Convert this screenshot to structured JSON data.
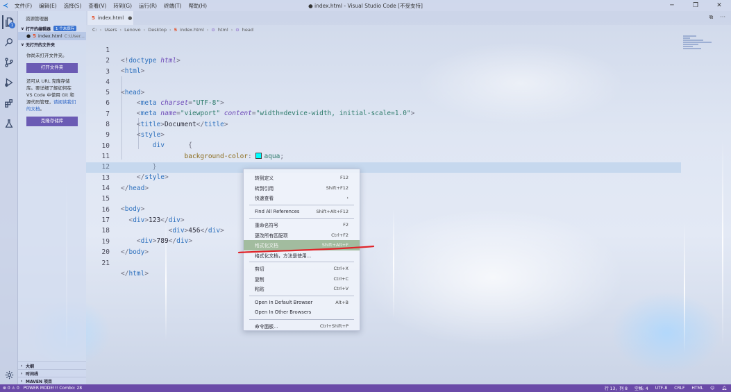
{
  "window": {
    "title": "● index.html - Visual Studio Code [不受支持]",
    "menu": [
      "文件(F)",
      "编辑(E)",
      "选择(S)",
      "查看(V)",
      "转到(G)",
      "运行(R)",
      "终端(T)",
      "帮助(H)"
    ]
  },
  "sidebar": {
    "header": "资源管理器",
    "open_editors_label": "打开的编辑器",
    "unsaved_badge": "1 个未保存",
    "open_file_name": "index.html",
    "open_file_path": "C:\\User...",
    "no_folder_label": "无打开的文件夹",
    "no_folder_msg": "你尚未打开文件夹。",
    "open_folder_button": "打开文件夹",
    "clone_msg": "还可从 URL 克隆存储库。要详细了解如何在 VS Code 中使用 Git 和源代码管理，",
    "clone_link": "请阅读我们的文档",
    "clone_msg_end": "。",
    "clone_button": "克隆存储库",
    "bottom_sections": [
      "大纲",
      "时间线",
      "MAVEN 项目"
    ]
  },
  "tab": {
    "name": "index.html"
  },
  "breadcrumb": [
    "C:",
    "Users",
    "Lenovo",
    "Desktop",
    "index.html",
    "html",
    "head"
  ],
  "editor": {
    "lines": [
      {
        "n": "1"
      },
      {
        "n": "2"
      },
      {
        "n": "3"
      },
      {
        "n": "4"
      },
      {
        "n": "5"
      },
      {
        "n": "6"
      },
      {
        "n": "7"
      },
      {
        "n": "8"
      },
      {
        "n": "9"
      },
      {
        "n": "10"
      },
      {
        "n": "11"
      },
      {
        "n": "12"
      },
      {
        "n": "13"
      },
      {
        "n": "14"
      },
      {
        "n": "15"
      },
      {
        "n": "16"
      },
      {
        "n": "17"
      },
      {
        "n": "18"
      },
      {
        "n": "19"
      },
      {
        "n": "20"
      },
      {
        "n": "21"
      }
    ],
    "tokens": {
      "doctype_open": "<!",
      "doctype_kw": "doctype",
      "doctype_val": "html",
      "doctype_close": ">",
      "html": "html",
      "head": "head",
      "meta": "meta",
      "charset_attr": "charset",
      "charset_val": "\"UTF-8\"",
      "name_attr": "name",
      "name_val": "\"viewport\"",
      "content_attr": "content",
      "content_val": "\"width=device-width, initial-scale=1.0\"",
      "title": "title",
      "title_text": "Document",
      "style": "style",
      "selector": "div",
      "brace_open": "{",
      "brace_close": "}",
      "prop": "background-color",
      "prop_val": "aqua",
      "body": "body",
      "div": "div",
      "text_123": "123",
      "text_456": "456",
      "text_789": "789"
    }
  },
  "context_menu": {
    "items": [
      {
        "label": "转到定义",
        "key": "F12"
      },
      {
        "label": "转到引用",
        "key": "Shift+F12"
      },
      {
        "label": "快速查看",
        "key": "›"
      },
      {
        "label": "Find All References",
        "key": "Shift+Alt+F12"
      },
      {
        "label": "重命名符号",
        "key": "F2"
      },
      {
        "label": "更改所有匹配项",
        "key": "Ctrl+F2"
      },
      {
        "label": "格式化文档",
        "key": "Shift+Alt+F"
      },
      {
        "label": "格式化文档，方法是使用...",
        "key": ""
      },
      {
        "label": "剪切",
        "key": "Ctrl+X"
      },
      {
        "label": "复制",
        "key": "Ctrl+C"
      },
      {
        "label": "粘贴",
        "key": "Ctrl+V"
      },
      {
        "label": "Open In Default Browser",
        "key": "Alt+B"
      },
      {
        "label": "Open In Other Browsers",
        "key": ""
      },
      {
        "label": "命令面板...",
        "key": "Ctrl+Shift+P"
      }
    ]
  },
  "statusbar": {
    "problems": "⊗ 0 ⚠ 0",
    "power_mode": "POWER MODE!!! Combo: 28",
    "position": "行 13，列 8",
    "spaces": "空格: 4",
    "encoding": "UTF-8",
    "eol": "CRLF",
    "language": "HTML"
  },
  "colors": {
    "accent": "#6b5bb4",
    "status": "#6a4aa8",
    "highlight": "#82a578",
    "annotation": "#e0242a",
    "aqua": "#00ffff"
  }
}
